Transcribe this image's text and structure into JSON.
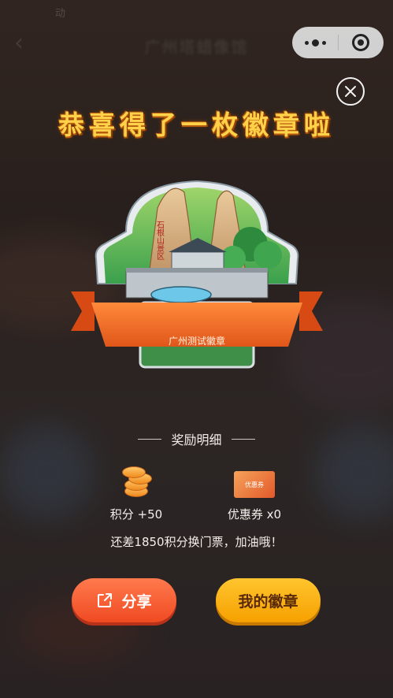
{
  "background": {
    "status_left": "动",
    "status_right": "",
    "nav_title": "广州塔蜡像馆"
  },
  "overlay": {
    "headline": "恭喜得了一枚徽章啦",
    "badge": {
      "name": "广州测试徽章",
      "mountain_text": "石根山景区"
    },
    "reward_section": {
      "title": "奖励明细",
      "items": [
        {
          "icon": "coin-stack-icon",
          "label": "积分 +50"
        },
        {
          "icon": "coupon-icon",
          "label": "优惠券 x0",
          "icon_text": "优惠券"
        }
      ],
      "hint": "还差1850积分换门票，加油哦！"
    },
    "buttons": {
      "share_label": "分享",
      "my_badges_label": "我的徽章"
    }
  },
  "colors": {
    "headline": "#ffd24a",
    "share_button": "#f04a22",
    "my_badges_button": "#f6a000",
    "badge_ribbon": "#ef6a1f"
  }
}
